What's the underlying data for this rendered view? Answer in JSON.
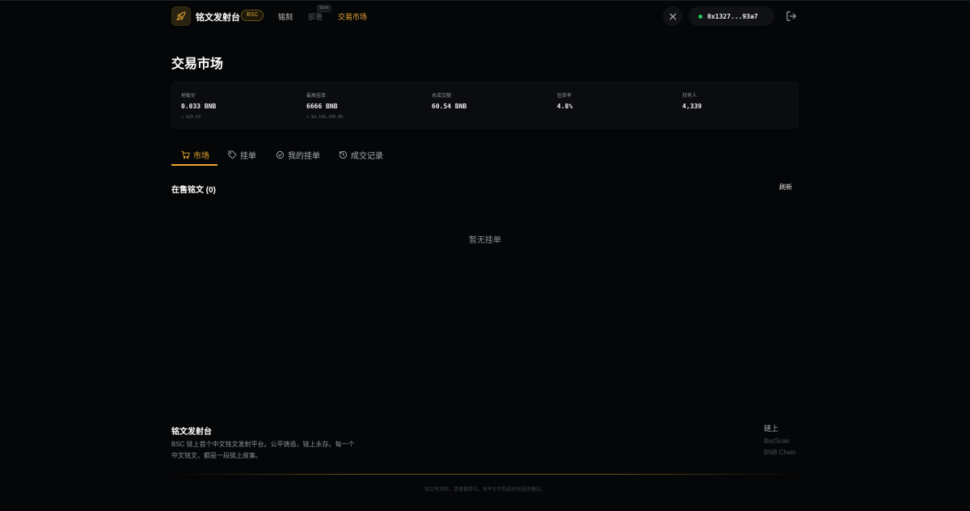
{
  "header": {
    "brand": "铭文发射台",
    "chain_badge": "BSC",
    "nav": {
      "mint": "铭刻",
      "deploy": "部署",
      "deploy_tag": "Soon",
      "market": "交易市场"
    },
    "x_icon": "x-logo-icon",
    "wallet_address": "0x1327...93a7",
    "accent": "#e7a933"
  },
  "page_title": "交易市场",
  "stats": [
    {
      "label": "地板价",
      "value": "0.033 BNB",
      "sub": "≈ $20.63"
    },
    {
      "label": "最高挂单",
      "value": "6666 BNB",
      "sub": "≈ $4,166,250.00"
    },
    {
      "label": "总成交额",
      "value": "60.54 BNB",
      "sub": ""
    },
    {
      "label": "挂单率",
      "value": "4.8%",
      "sub": ""
    },
    {
      "label": "持有人",
      "value": "4,339",
      "sub": ""
    }
  ],
  "tabs": [
    {
      "label": "市场",
      "icon": "cart-icon"
    },
    {
      "label": "挂单",
      "icon": "tag-icon"
    },
    {
      "label": "我的挂单",
      "icon": "check-circle-icon"
    },
    {
      "label": "成交记录",
      "icon": "history-icon"
    }
  ],
  "listing": {
    "title": "在售铭文 (0)",
    "refresh": "刷新",
    "empty": "暂无挂单"
  },
  "footer": {
    "title": "铭文发射台",
    "description": "BSC 链上首个中文铭文发射平台。公平铸造，链上永存。每一个中文铭文，都是一段链上故事。",
    "links_title": "链上",
    "links": [
      "BscScan",
      "BNB Chain"
    ],
    "copyright": "铭文有风险，请谨慎参与。本平台不构成任何投资建议。"
  }
}
